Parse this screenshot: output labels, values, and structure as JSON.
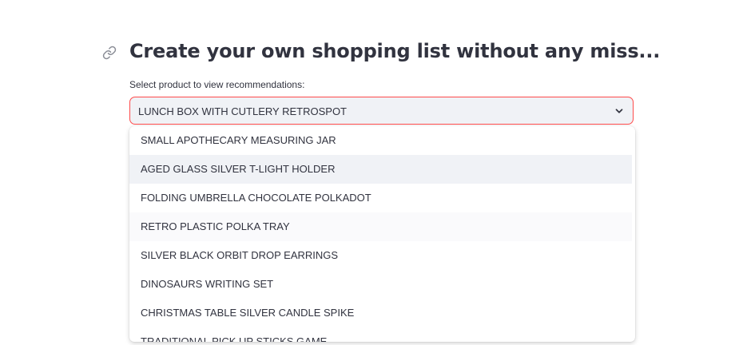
{
  "header": {
    "title": "Create your own shopping list without any miss...",
    "anchor_icon": "link-icon"
  },
  "select": {
    "label": "Select product to view recommendations:",
    "value": "LUNCH BOX WITH CUTLERY RETROSPOT",
    "chevron_icon": "chevron-down-icon",
    "accent_color": "#ff4b4b"
  },
  "dropdown": {
    "options": [
      "SMALL APOTHECARY MEASURING JAR",
      "AGED GLASS SILVER T-LIGHT HOLDER",
      "FOLDING UMBRELLA CHOCOLATE POLKADOT",
      "RETRO PLASTIC POLKA TRAY",
      "SILVER BLACK ORBIT DROP EARRINGS",
      "DINOSAURS WRITING SET",
      "CHRISTMAS TABLE SILVER CANDLE SPIKE",
      "TRADITIONAL PICK UP STICKS GAME"
    ]
  }
}
